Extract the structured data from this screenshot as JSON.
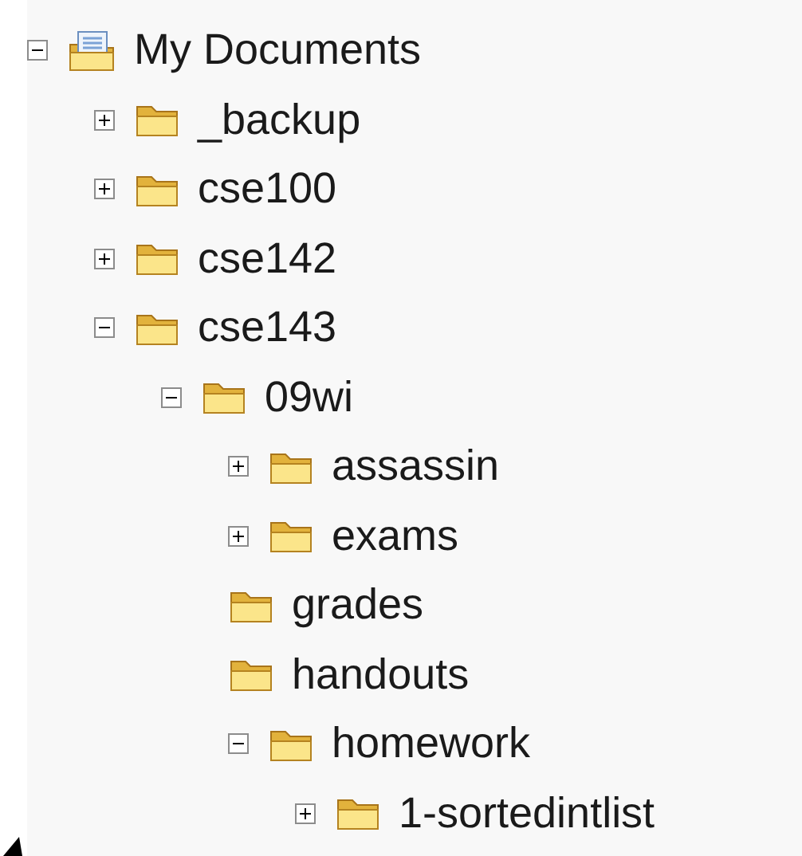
{
  "tree": [
    {
      "label": "My Documents",
      "kind": "documents",
      "leaf": false,
      "expanded": true,
      "children": [
        {
          "label": "_backup",
          "kind": "folder",
          "leaf": false,
          "expanded": false
        },
        {
          "label": "cse100",
          "kind": "folder",
          "leaf": false,
          "expanded": false
        },
        {
          "label": "cse142",
          "kind": "folder",
          "leaf": false,
          "expanded": false
        },
        {
          "label": "cse143",
          "kind": "folder",
          "leaf": false,
          "expanded": true,
          "children": [
            {
              "label": "09wi",
              "kind": "folder",
              "leaf": false,
              "expanded": true,
              "children": [
                {
                  "label": "assassin",
                  "kind": "folder",
                  "leaf": false,
                  "expanded": false
                },
                {
                  "label": "exams",
                  "kind": "folder",
                  "leaf": false,
                  "expanded": false
                },
                {
                  "label": "grades",
                  "kind": "folder",
                  "leaf": true
                },
                {
                  "label": "handouts",
                  "kind": "folder",
                  "leaf": true
                },
                {
                  "label": "homework",
                  "kind": "folder",
                  "leaf": false,
                  "expanded": true,
                  "children": [
                    {
                      "label": "1-sortedintlist",
                      "kind": "folder",
                      "leaf": false,
                      "expanded": false
                    }
                  ]
                }
              ]
            }
          ]
        }
      ]
    }
  ]
}
